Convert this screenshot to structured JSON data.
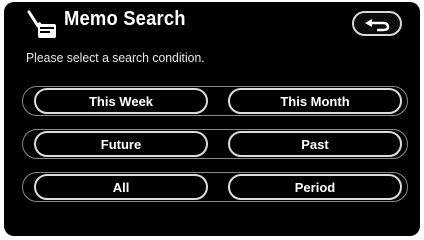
{
  "header": {
    "title": "Memo Search",
    "icon": "memo-search-icon",
    "return_icon": "return-arrow-icon"
  },
  "instruction": "Please select a search condition.",
  "buttons": {
    "this_week": "This Week",
    "this_month": "This Month",
    "future": "Future",
    "past": "Past",
    "all": "All",
    "period": "Period"
  },
  "colors": {
    "background": "#000000",
    "button_border": "#dcdcdc",
    "text": "#ffffff"
  }
}
